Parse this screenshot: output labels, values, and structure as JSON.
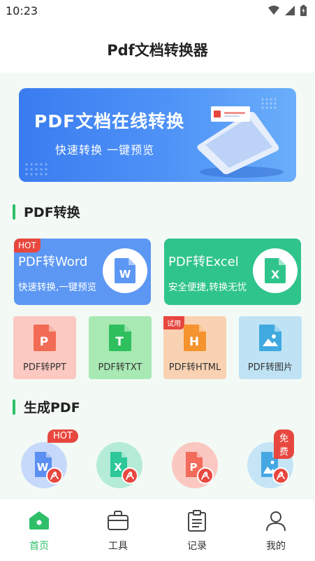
{
  "status_bar": {
    "time": "10:23"
  },
  "header": {
    "title": "Pdf文档转换器"
  },
  "banner": {
    "title": "PDF文档在线转换",
    "subtitle": "快速转换   一键预览"
  },
  "sections": {
    "pdf_convert": "PDF转换",
    "generate_pdf": "生成PDF"
  },
  "big_cards": [
    {
      "title": "PDF转Word",
      "subtitle": "快速转换,一键预览",
      "badge": "HOT",
      "color": "#5c97f4",
      "icon": "word-doc-icon"
    },
    {
      "title": "PDF转Excel",
      "subtitle": "安全便捷,转换无忧",
      "color": "#2fc48b",
      "icon": "excel-doc-icon"
    }
  ],
  "tiles": [
    {
      "label": "PDF转PPT",
      "bg": "#fbc9c1",
      "icon_color": "#f26b55",
      "letter": "P",
      "icon": "ppt-file-icon"
    },
    {
      "label": "PDF转TXT",
      "bg": "#a8e9b4",
      "icon_color": "#2fbf5c",
      "letter": "T",
      "icon": "txt-file-icon"
    },
    {
      "label": "PDF转HTML",
      "bg": "#f8d2b3",
      "icon_color": "#f5932f",
      "letter": "H",
      "badge": "试用",
      "icon": "html-file-icon"
    },
    {
      "label": "PDF转图片",
      "bg": "#bfe3f5",
      "icon_color": "#3fa9e0",
      "letter": "",
      "icon": "image-file-icon"
    }
  ],
  "generate": [
    {
      "badge": "HOT",
      "bg": "#c7d9fb",
      "doc": "#5c8ff2",
      "letter": "W",
      "icon": "word-to-pdf-icon"
    },
    {
      "bg": "#b4ecd7",
      "doc": "#2ec79a",
      "letter": "X",
      "icon": "excel-to-pdf-icon"
    },
    {
      "bg": "#fbc8c1",
      "doc": "#f26b5b",
      "letter": "P",
      "icon": "ppt-to-pdf-icon"
    },
    {
      "badge": "免费",
      "bg": "#c5e4f6",
      "doc": "#45a8e2",
      "letter": "",
      "icon": "image-to-pdf-icon"
    }
  ],
  "bottom_nav": [
    {
      "label": "首页",
      "active": true,
      "icon": "home-icon"
    },
    {
      "label": "工具",
      "icon": "briefcase-icon"
    },
    {
      "label": "记录",
      "icon": "clipboard-icon"
    },
    {
      "label": "我的",
      "icon": "user-icon"
    }
  ],
  "colors": {
    "accent": "#2fbf6a",
    "badge": "#e8473f",
    "banner": "#4f93f7"
  }
}
